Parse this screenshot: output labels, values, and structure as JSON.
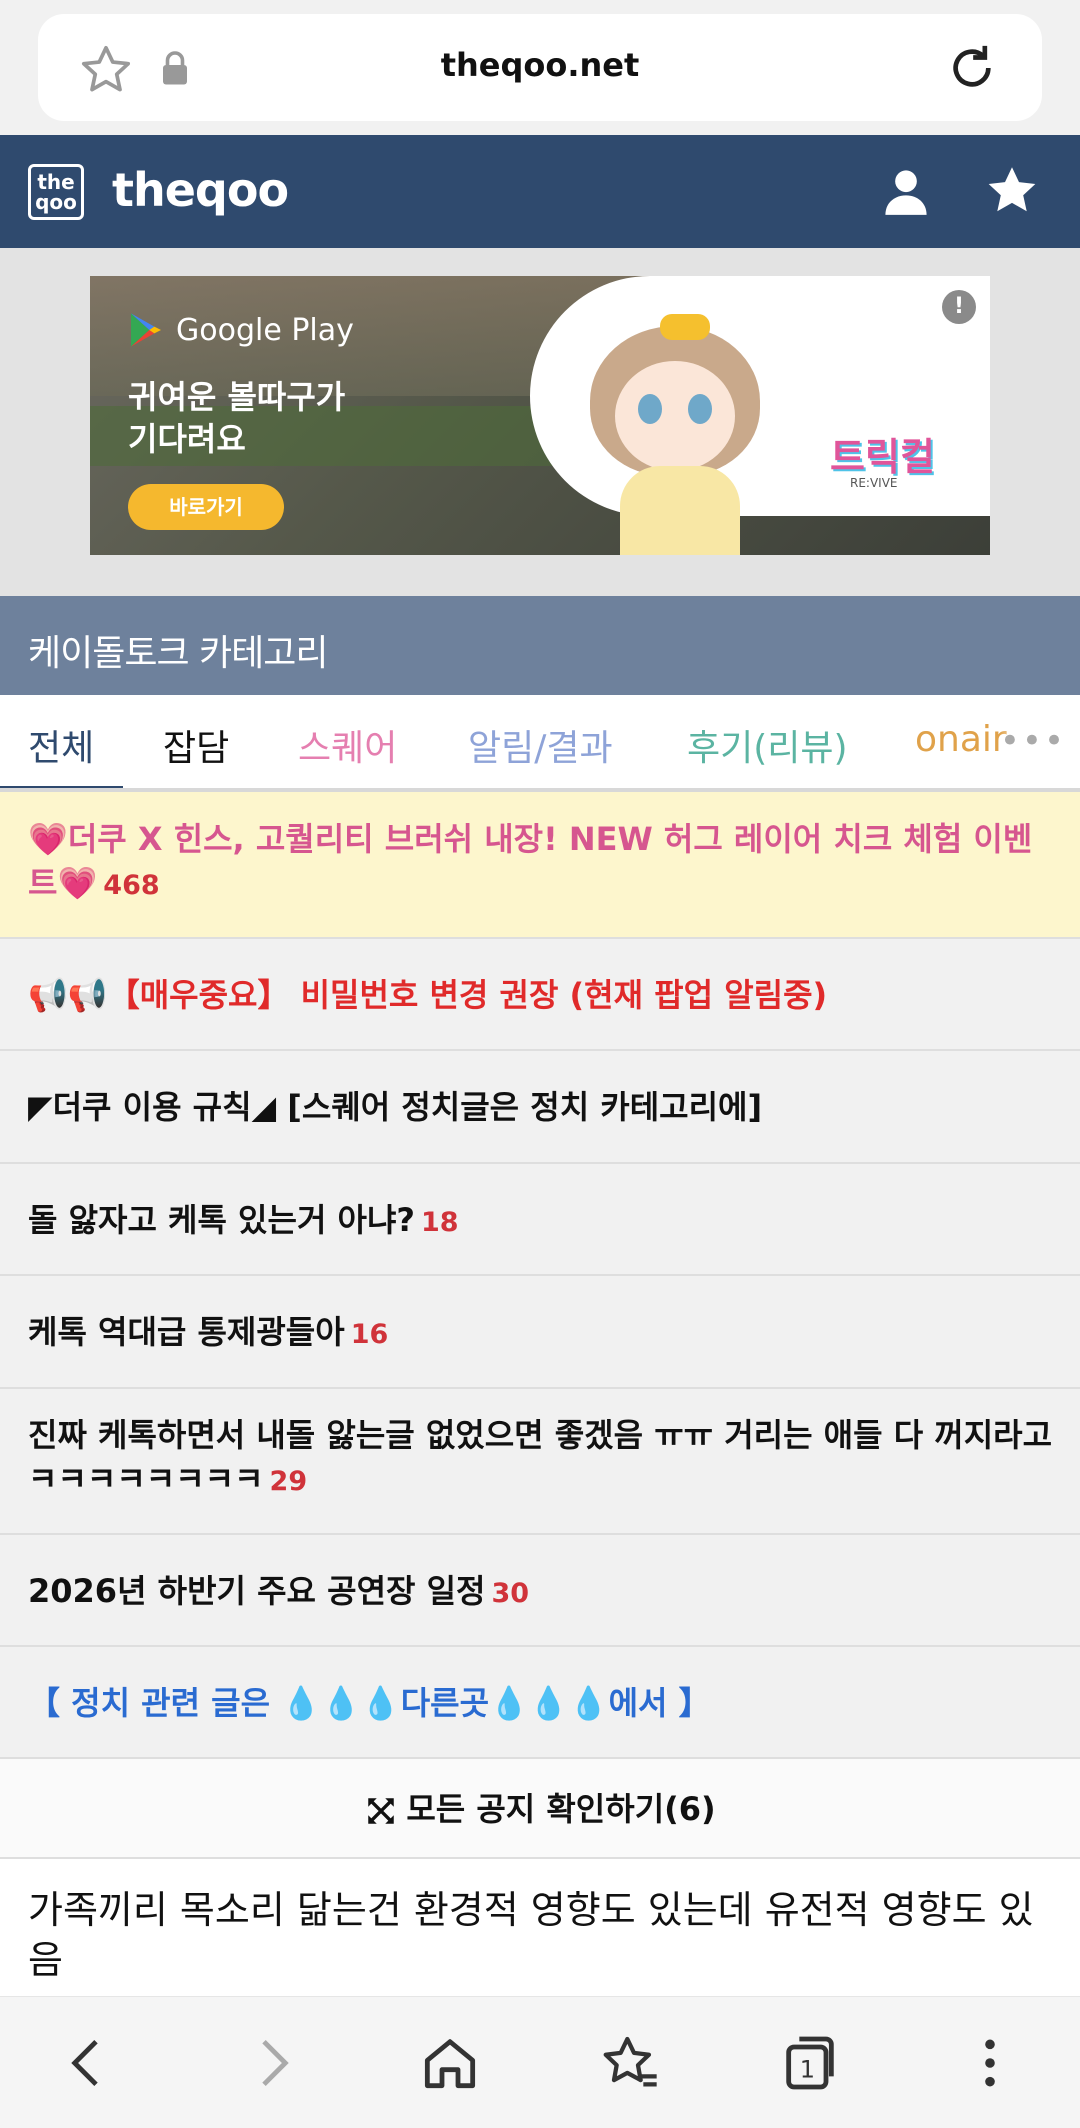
{
  "browser": {
    "url": "theqoo.net"
  },
  "header": {
    "logo_text": "the qoo",
    "site_title": "theqoo"
  },
  "ad": {
    "store_label": "Google Play",
    "headline_line1": "귀여운 볼따구가",
    "headline_line2": "기다려요",
    "cta": "바로가기",
    "info_badge": "!",
    "game_title": "트릭컬",
    "game_subtitle": "RE:VIVE"
  },
  "category": {
    "title": "케이돌토크 카테고리"
  },
  "tabs": [
    {
      "label": "전체",
      "color": "#2f4a6e"
    },
    {
      "label": "잡담",
      "color": "#111111"
    },
    {
      "label": "스퀘어",
      "color": "#e57fb0"
    },
    {
      "label": "알림/결과",
      "color": "#8ea3d8"
    },
    {
      "label": "후기(리뷰)",
      "color": "#5bb4a2"
    },
    {
      "label": "onair",
      "color": "#e0a24a"
    }
  ],
  "tabs_more": "•••",
  "notices": [
    {
      "text": "💗더쿠 X 힌스, 고퀄리티 브러쉬 내장! NEW 허그 레이어 치크 체험 이벤트💗",
      "count": "468"
    },
    {
      "text": "📢📢【매우중요】 비밀번호 변경 권장 (현재 팝업 알림중)"
    },
    {
      "text": "◤더쿠 이용 규칙◢ [스퀘어 정치글은 정치 카테고리에]"
    },
    {
      "text": "돌 앓자고 케톡 있는거 아냐?",
      "count": "18"
    },
    {
      "text": "케톡 역대급 통제광들아",
      "count": "16"
    },
    {
      "text": "진짜 케톡하면서 내돌 앓는글 없었으면 좋겠음 ㅠㅠ 거리는 애들 다 꺼지라고 ㅋㅋㅋㅋㅋㅋㅋㅋ",
      "count": "29"
    },
    {
      "text": "2026년 하반기 주요 공연장 일정",
      "count": "30"
    },
    {
      "text": "【 정치 관련 글은 💧💧💧다른곳💧💧💧에서 】"
    }
  ],
  "all_notices": "모든 공지 확인하기(6)",
  "posts": [
    {
      "text": "가족끼리 목소리 닮는건 환경적 영향도 있는데 유전적 영향도 있음"
    }
  ],
  "icons": {
    "bookmark_star": "star-outline-icon",
    "lock": "lock-icon",
    "reload": "reload-icon",
    "user": "user-icon",
    "favorite": "star-filled-icon",
    "expand": "expand-arrows-icon",
    "back": "chevron-left-icon",
    "forward": "chevron-right-icon",
    "home": "home-icon",
    "bookmarks": "bookmarks-star-icon",
    "tabs": "tabs-icon",
    "menu": "more-vertical-icon"
  },
  "bottom_nav": {
    "tab_count": "1"
  }
}
